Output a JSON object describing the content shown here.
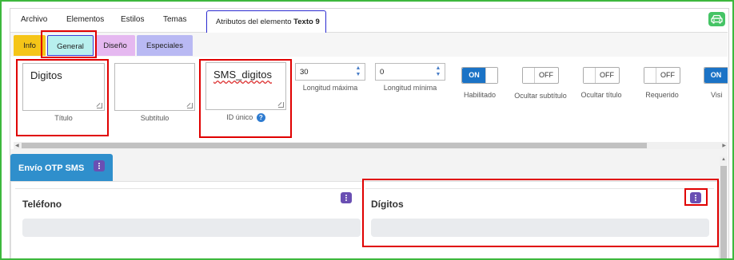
{
  "menubar": {
    "items": [
      "Archivo",
      "Elementos",
      "Estilos",
      "Temas"
    ],
    "active_tab_prefix": "Atributos del elemento ",
    "active_tab_bold": "Texto 9"
  },
  "subtabs": [
    "Info",
    "General",
    "Diseño",
    "Especiales"
  ],
  "props": {
    "titulo": {
      "value": "Digitos",
      "label": "Título"
    },
    "subtitulo": {
      "value": "",
      "label": "Subtítulo"
    },
    "id_unico": {
      "value": "SMS_digitos",
      "label": "ID único"
    },
    "longitud_maxima": {
      "value": "30",
      "label": "Longitud máxima"
    },
    "longitud_minima": {
      "value": "0",
      "label": "Longitud mínima"
    },
    "habilitado": {
      "state": "ON",
      "label": "Habilitado"
    },
    "ocultar_subtitulo": {
      "state": "OFF",
      "label": "Ocultar subtítulo"
    },
    "ocultar_titulo": {
      "state": "OFF",
      "label": "Ocultar título"
    },
    "requerido": {
      "state": "OFF",
      "label": "Requerido"
    },
    "visible": {
      "state": "ON",
      "label": "Visi"
    }
  },
  "form": {
    "tab_label": "Envío OTP SMS",
    "fields": [
      {
        "title": "Teléfono"
      },
      {
        "title": "Dígitos"
      }
    ]
  },
  "colors": {
    "frame": "#3db83d",
    "info_tab": "#f5c518",
    "general_tab": "#b8f0ee",
    "diseno_tab": "#e5b8f0",
    "especiales_tab": "#b9b9f3",
    "toggle_on": "#1b73c6",
    "form_tab": "#2f8fcc",
    "kebab": "#6a4fb3",
    "annotation": "#e00000"
  }
}
